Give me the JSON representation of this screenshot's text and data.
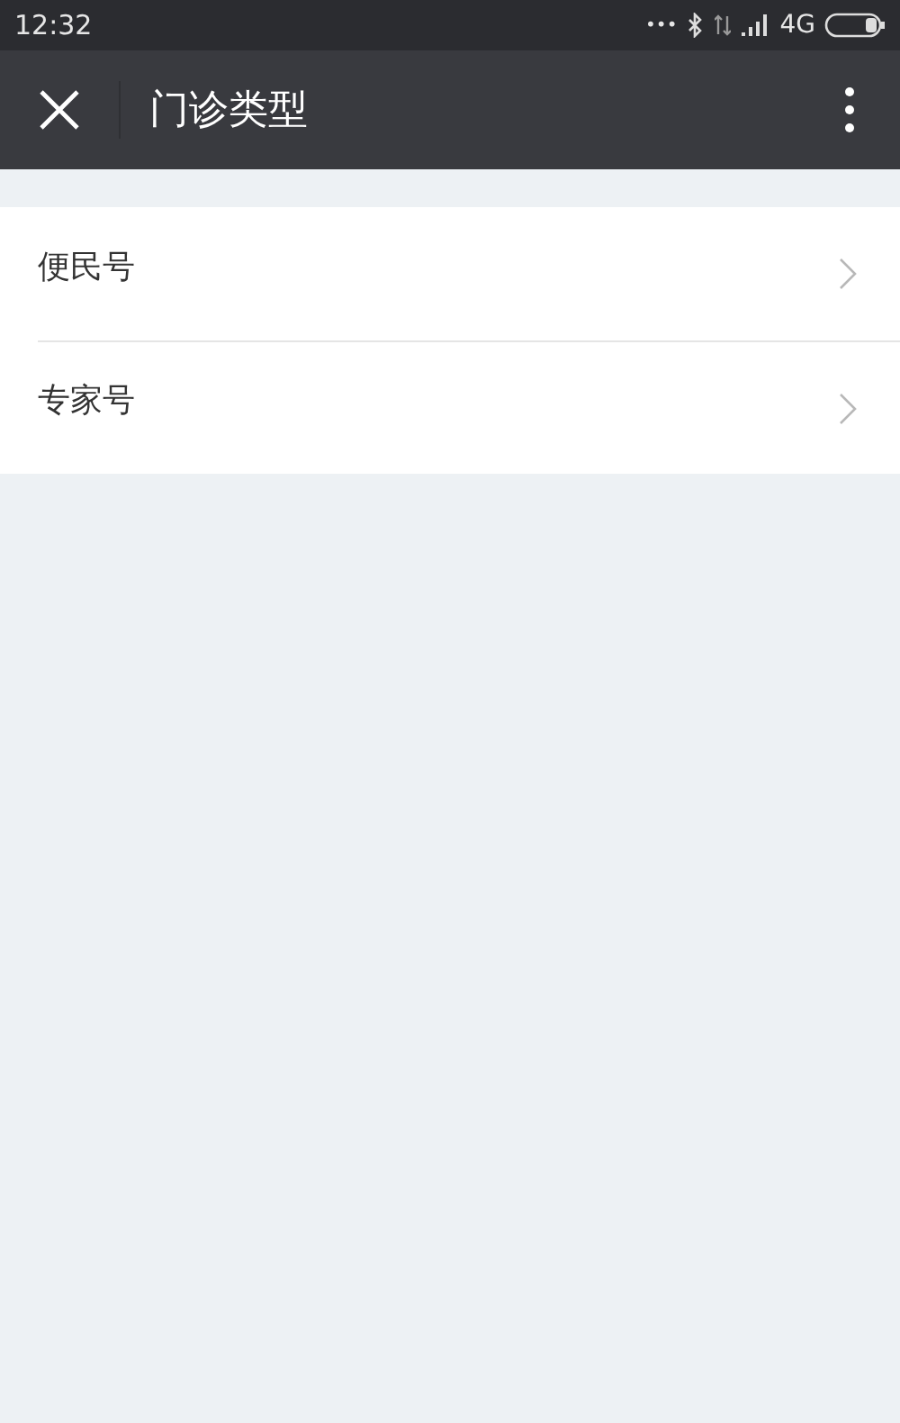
{
  "status_bar": {
    "time": "12:32",
    "dots": "•••",
    "network": "4G"
  },
  "nav_bar": {
    "title": "门诊类型"
  },
  "list": [
    {
      "label": "便民号"
    },
    {
      "label": "专家号"
    }
  ]
}
